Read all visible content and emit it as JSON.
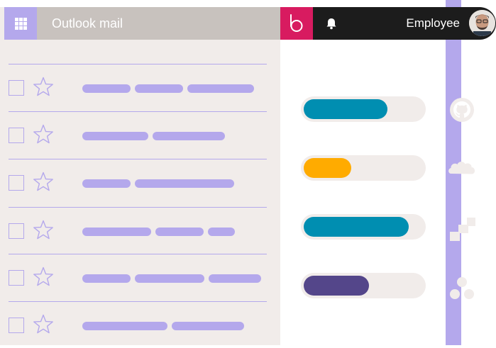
{
  "header": {
    "app_title": "Outlook mail",
    "user_label": "Employee",
    "grid_icon": "grid-icon",
    "brand_icon": "b-logo-icon",
    "bell_icon": "bell-icon"
  },
  "colors": {
    "accent": "#b4a8ec",
    "brand": "#d81b60",
    "teal": "#008eb1",
    "orange": "#ffab00",
    "purple": "#54468a",
    "panel": "#f1ecea",
    "topbar": "#c8c2be",
    "dark": "#1c1c1c"
  },
  "progress_items": [
    {
      "app": "github",
      "icon": "github-icon",
      "fill_percent": 70,
      "color": "#008eb1"
    },
    {
      "app": "salesforce",
      "icon": "salesforce-cloud-icon",
      "fill_percent": 40,
      "color": "#ffab00"
    },
    {
      "app": "jira",
      "icon": "jira-icon",
      "fill_percent": 88,
      "color": "#008eb1"
    },
    {
      "app": "asana",
      "icon": "asana-icon",
      "fill_percent": 55,
      "color": "#54468a"
    }
  ]
}
